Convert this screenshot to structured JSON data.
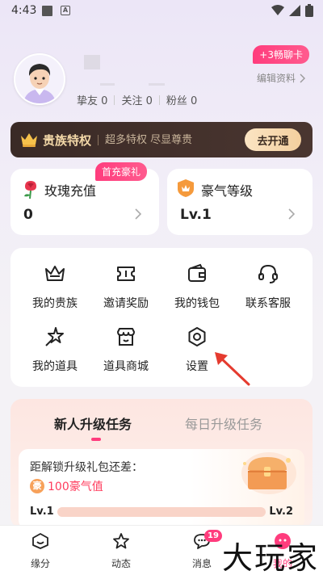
{
  "status_bar": {
    "time": "4:43",
    "a_icon_text": "A"
  },
  "profile": {
    "stats": [
      {
        "label": "挚友",
        "value": "0"
      },
      {
        "label": "关注",
        "value": "0"
      },
      {
        "label": "粉丝",
        "value": "0"
      }
    ],
    "chat_card_badge": "+3畅聊卡",
    "edit_profile": "编辑资料"
  },
  "noble": {
    "title": "贵族特权",
    "subtitle": "超多特权 尽显尊贵",
    "open_button": "去开通"
  },
  "rose_card": {
    "title": "玫瑰充值",
    "value": "0",
    "badge": "首充豪礼"
  },
  "level_card": {
    "title": "豪气等级",
    "value": "Lv.1"
  },
  "menu": {
    "items": [
      {
        "label": "我的贵族",
        "icon": "crown-outline-icon"
      },
      {
        "label": "邀请奖励",
        "icon": "ticket-icon"
      },
      {
        "label": "我的钱包",
        "icon": "wallet-icon"
      },
      {
        "label": "联系客服",
        "icon": "headset-icon"
      },
      {
        "label": "我的道具",
        "icon": "star-wand-icon"
      },
      {
        "label": "道具商城",
        "icon": "store-icon"
      },
      {
        "label": "设置",
        "icon": "settings-hexagon-icon"
      }
    ]
  },
  "tasks": {
    "tabs": [
      "新人升级任务",
      "每日升级任务"
    ],
    "line1": "距解锁升级礼包还差：",
    "hao_badge": "豪",
    "amount": "100豪气值",
    "level_from": "Lv.1",
    "level_to": "Lv.2",
    "progress": 0
  },
  "tabbar": {
    "items": [
      {
        "label": "缘分",
        "icon": "smile-box-icon"
      },
      {
        "label": "动态",
        "icon": "star-outline-icon"
      },
      {
        "label": "消息",
        "icon": "chat-bubble-icon",
        "badge": "19"
      },
      {
        "label": "我的",
        "icon": "profile-icon"
      }
    ]
  },
  "watermark": "大玩家",
  "colors": {
    "accent": "#ff3c7d",
    "noble_bg": "#3a2a26",
    "gold": "#f3d8a8"
  }
}
